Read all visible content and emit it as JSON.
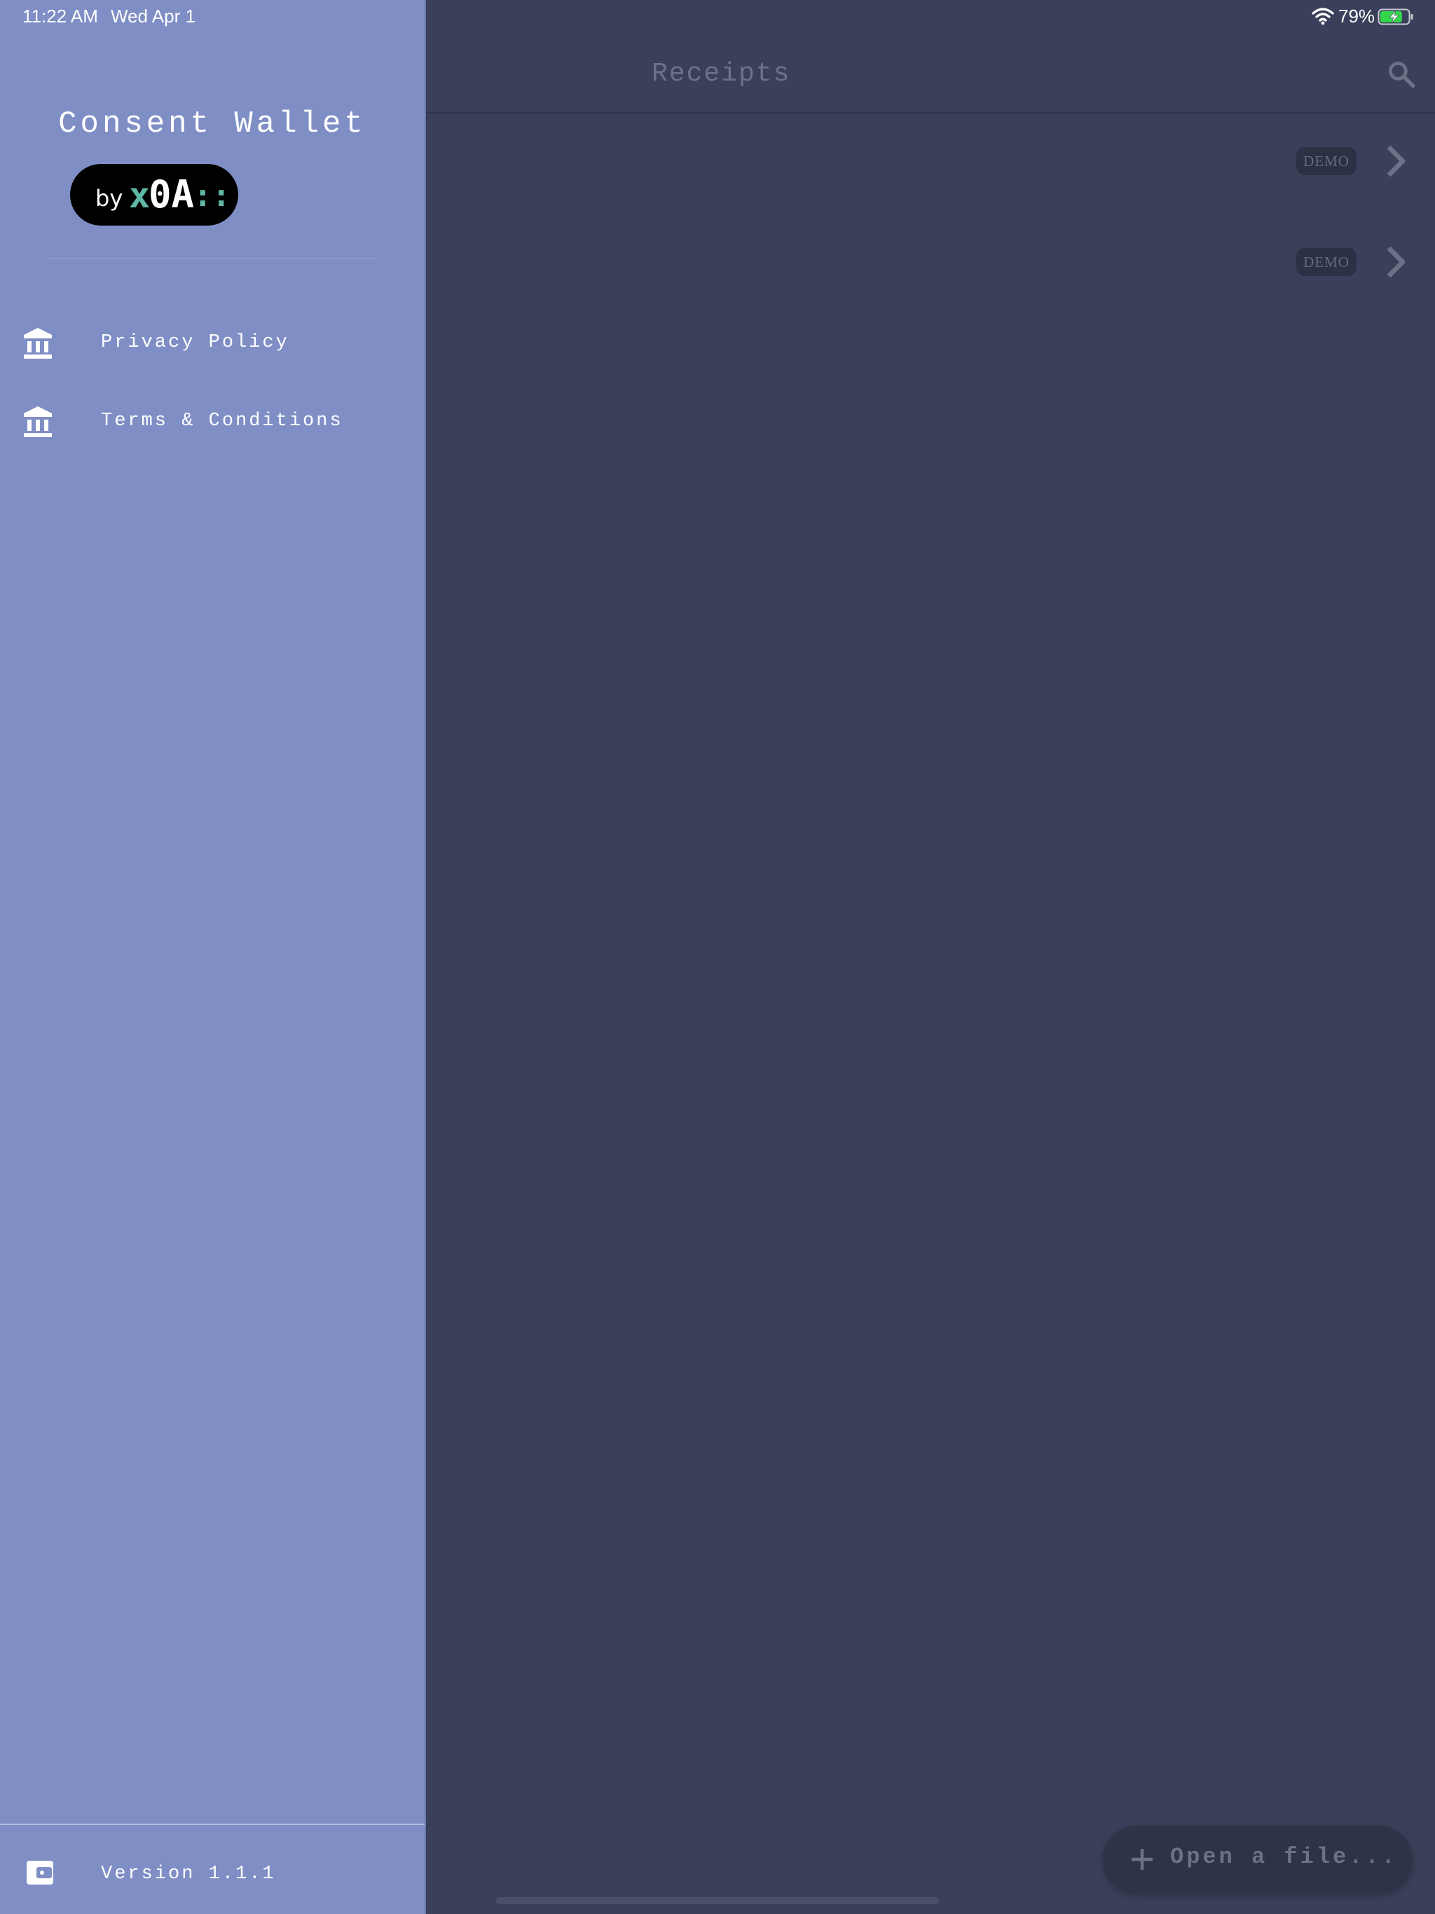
{
  "status_bar": {
    "time": "11:22 AM",
    "date": "Wed Apr 1",
    "battery_percent": "79%",
    "wifi_icon": "wifi-icon",
    "battery_icon": "battery-charging-icon",
    "battery_level": 0.79,
    "battery_fill_color": "#32d74b"
  },
  "app_bar": {
    "title": "Receipts",
    "search_icon": "search-icon"
  },
  "receipts": {
    "rows": [
      {
        "badge": "DEMO",
        "chevron_icon": "chevron-right-icon"
      },
      {
        "badge": "DEMO",
        "chevron_icon": "chevron-right-icon"
      }
    ]
  },
  "fab": {
    "icon": "plus-icon",
    "label": "Open a file..."
  },
  "drawer": {
    "title": "Consent Wallet",
    "brand": {
      "by": "by",
      "x": "x",
      "zero_a": "0A",
      "dots": "::"
    },
    "menu": [
      {
        "label": "Privacy Policy",
        "icon": "bank-icon"
      },
      {
        "label": "Terms & Conditions",
        "icon": "bank-icon"
      }
    ],
    "version_icon": "wallet-icon",
    "version": "Version 1.1.1"
  },
  "colors": {
    "drawer_bg": "#7f8ec5",
    "scrim_bg": "#3a405a",
    "brand_accent": "#5fb8a4",
    "brand_pill": "#000000"
  }
}
